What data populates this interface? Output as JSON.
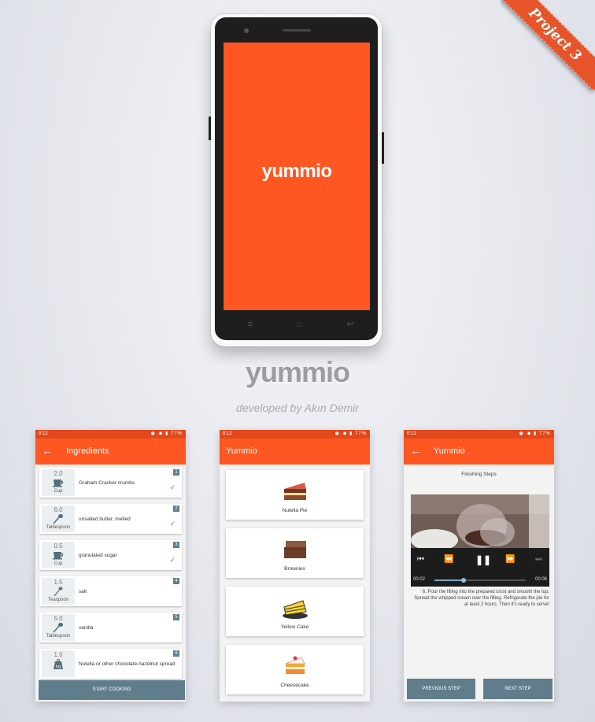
{
  "ribbon": {
    "label": "Project 3"
  },
  "phone": {
    "splash_title": "yummio"
  },
  "title": "yummio",
  "subtitle": "developed by Akın Demir",
  "status": {
    "time": "0:12",
    "battery": "77%"
  },
  "ingredients_screen": {
    "title": "Ingredients",
    "items": [
      {
        "qty": "2.0",
        "unit": "Cup",
        "name": "Graham Cracker crumbs",
        "index": "1",
        "checked": true
      },
      {
        "qty": "6.0",
        "unit": "Tablespoon",
        "name": "unsalted butter, melted",
        "index": "2",
        "checked": true
      },
      {
        "qty": "0.5",
        "unit": "Cup",
        "name": "granulated sugar",
        "index": "3",
        "checked": true
      },
      {
        "qty": "1.5",
        "unit": "Teaspoon",
        "name": "salt",
        "index": "4",
        "checked": false
      },
      {
        "qty": "5.0",
        "unit": "Tablespoon",
        "name": "vanilla",
        "index": "5",
        "checked": false
      },
      {
        "qty": "1.0",
        "unit": "kg",
        "name": "Nutella or other chocolate-hazelnut spread",
        "index": "6",
        "checked": false
      }
    ],
    "start_button": "START COOKING"
  },
  "recipes_screen": {
    "title": "Yummio",
    "recipes": [
      "Nutella Pie",
      "Brownies",
      "Yellow Cake",
      "Cheesecake"
    ]
  },
  "steps_screen": {
    "title": "Yummio",
    "step_title": "Finishing Steps",
    "time_current": "00:02",
    "time_total": "00:06",
    "progress": 0.32,
    "description": "6. Pour the filling into the prepared crust and smooth the top. Spread the whipped cream over the filling. Refrigerate the pie for at least 2 hours. Then it's ready to serve!",
    "prev_button": "PREVIOUS STEP",
    "next_button": "NEXT STEP"
  },
  "colors": {
    "primary": "#fe5722",
    "primary_dark": "#e0491c",
    "accent_grey": "#607d8b"
  }
}
